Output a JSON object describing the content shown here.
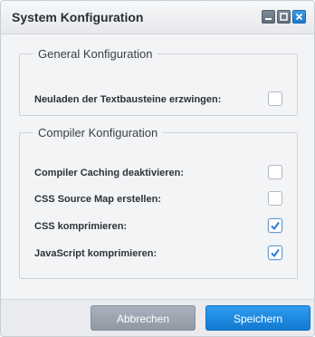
{
  "window": {
    "title": "System Konfiguration",
    "controls": [
      "minimize-icon",
      "maximize-icon",
      "close-icon"
    ]
  },
  "general": {
    "legend": "General Konfiguration",
    "options": [
      {
        "label": "Neuladen der Textbausteine erzwingen:",
        "checked": false
      }
    ]
  },
  "compiler": {
    "legend": "Compiler Konfiguration",
    "options": [
      {
        "label": "Compiler Caching deaktivieren:",
        "checked": false
      },
      {
        "label": "CSS Source Map erstellen:",
        "checked": false
      },
      {
        "label": "CSS komprimieren:",
        "checked": true
      },
      {
        "label": "JavaScript komprimieren:",
        "checked": true
      }
    ]
  },
  "footer": {
    "cancel_label": "Abbrechen",
    "save_label": "Speichern"
  },
  "colors": {
    "accent": "#1f86e0",
    "check": "#2a7bd0"
  }
}
